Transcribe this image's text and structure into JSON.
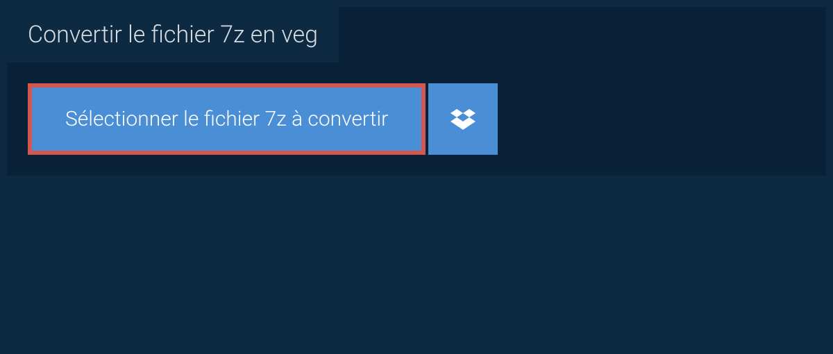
{
  "header": {
    "title": "Convertir le fichier 7z en veg"
  },
  "actions": {
    "select_file_label": "Sélectionner le fichier 7z à convertir"
  }
}
